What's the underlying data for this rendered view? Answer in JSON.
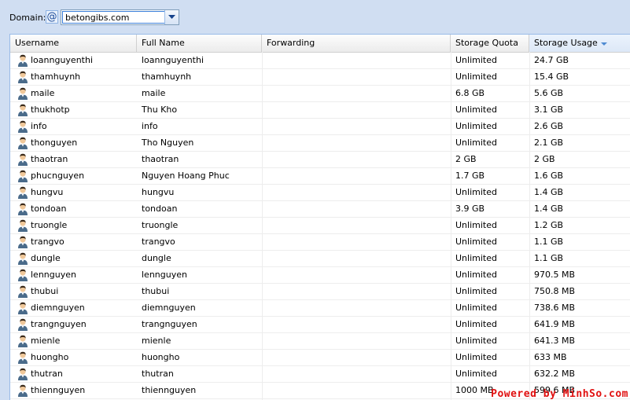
{
  "domain": {
    "label": "Domain:",
    "value": "betongibs.com",
    "at_icon": "@"
  },
  "columns": {
    "username": "Username",
    "full_name": "Full Name",
    "forwarding": "Forwarding",
    "storage_quota": "Storage Quota",
    "storage_usage": "Storage Usage"
  },
  "rows": [
    {
      "username": "loannguyenthi",
      "full_name": "loannguyenthi",
      "forwarding": "",
      "quota": "Unlimited",
      "usage": "24.7 GB"
    },
    {
      "username": "thamhuynh",
      "full_name": "thamhuynh",
      "forwarding": "",
      "quota": "Unlimited",
      "usage": "15.4 GB"
    },
    {
      "username": "maile",
      "full_name": "maile",
      "forwarding": "",
      "quota": "6.8 GB",
      "usage": "5.6 GB"
    },
    {
      "username": "thukhotp",
      "full_name": "Thu Kho",
      "forwarding": "",
      "quota": "Unlimited",
      "usage": "3.1 GB"
    },
    {
      "username": "info",
      "full_name": "info",
      "forwarding": "",
      "quota": "Unlimited",
      "usage": "2.6 GB"
    },
    {
      "username": "thonguyen",
      "full_name": "Tho Nguyen",
      "forwarding": "",
      "quota": "Unlimited",
      "usage": "2.1 GB"
    },
    {
      "username": "thaotran",
      "full_name": "thaotran",
      "forwarding": "",
      "quota": "2 GB",
      "usage": "2 GB"
    },
    {
      "username": "phucnguyen",
      "full_name": "Nguyen Hoang Phuc",
      "forwarding": "",
      "quota": "1.7 GB",
      "usage": "1.6 GB"
    },
    {
      "username": "hungvu",
      "full_name": "hungvu",
      "forwarding": "",
      "quota": "Unlimited",
      "usage": "1.4 GB"
    },
    {
      "username": "tondoan",
      "full_name": "tondoan",
      "forwarding": "",
      "quota": "3.9 GB",
      "usage": "1.4 GB"
    },
    {
      "username": "truongle",
      "full_name": "truongle",
      "forwarding": "",
      "quota": "Unlimited",
      "usage": "1.2 GB"
    },
    {
      "username": "trangvo",
      "full_name": "trangvo",
      "forwarding": "",
      "quota": "Unlimited",
      "usage": "1.1 GB"
    },
    {
      "username": "dungle",
      "full_name": "dungle",
      "forwarding": "",
      "quota": "Unlimited",
      "usage": "1.1 GB"
    },
    {
      "username": "lennguyen",
      "full_name": "lennguyen",
      "forwarding": "",
      "quota": "Unlimited",
      "usage": "970.5 MB"
    },
    {
      "username": "thubui",
      "full_name": "thubui",
      "forwarding": "",
      "quota": "Unlimited",
      "usage": "750.8 MB"
    },
    {
      "username": "diemnguyen",
      "full_name": "diemnguyen",
      "forwarding": "",
      "quota": "Unlimited",
      "usage": "738.6 MB"
    },
    {
      "username": "trangnguyen",
      "full_name": "trangnguyen",
      "forwarding": "",
      "quota": "Unlimited",
      "usage": "641.9 MB"
    },
    {
      "username": "mienle",
      "full_name": "mienle",
      "forwarding": "",
      "quota": "Unlimited",
      "usage": "641.3 MB"
    },
    {
      "username": "huongho",
      "full_name": "huongho",
      "forwarding": "",
      "quota": "Unlimited",
      "usage": "633 MB"
    },
    {
      "username": "thutran",
      "full_name": "thutran",
      "forwarding": "",
      "quota": "Unlimited",
      "usage": "632.2 MB"
    },
    {
      "username": "thiennguyen",
      "full_name": "thiennguyen",
      "forwarding": "",
      "quota": "1000 MB",
      "usage": "599.6 MB"
    }
  ],
  "icons": {
    "user": "user-icon",
    "sort": "sort-desc-icon",
    "combo": "chevron-down-icon"
  },
  "colors": {
    "background": "#d0def2",
    "border": "#99bbe8",
    "watermark": "#e01010"
  },
  "watermark": "Powered by MinhSo.com"
}
